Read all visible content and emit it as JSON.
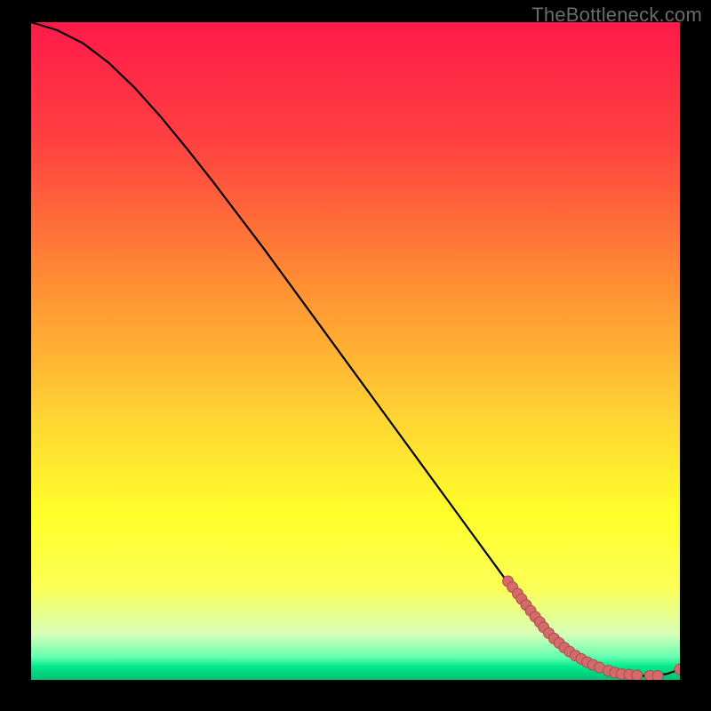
{
  "watermark": "TheBottleneck.com",
  "chart_data": {
    "type": "line",
    "title": "",
    "xlabel": "",
    "ylabel": "",
    "xlim": [
      0,
      100
    ],
    "ylim": [
      0,
      100
    ],
    "background_gradient": {
      "stops": [
        {
          "offset": 0,
          "color": "#ff1a4a"
        },
        {
          "offset": 18,
          "color": "#ff4040"
        },
        {
          "offset": 40,
          "color": "#ff8f33"
        },
        {
          "offset": 60,
          "color": "#ffd433"
        },
        {
          "offset": 75,
          "color": "#ffff2a"
        },
        {
          "offset": 86,
          "color": "#fbff55"
        },
        {
          "offset": 93,
          "color": "#d8ffb8"
        },
        {
          "offset": 96.5,
          "color": "#66ffb0"
        },
        {
          "offset": 98,
          "color": "#00e88a"
        },
        {
          "offset": 100,
          "color": "#00c074"
        }
      ]
    },
    "series": [
      {
        "name": "curve",
        "stroke": "#000000",
        "x": [
          0,
          4,
          8,
          12,
          16,
          20,
          24,
          28,
          32,
          36,
          40,
          44,
          48,
          52,
          56,
          60,
          64,
          68,
          72,
          76,
          80,
          84,
          86,
          88,
          90,
          92,
          94,
          96,
          98,
          100
        ],
        "y": [
          100,
          98.8,
          96.8,
          93.8,
          90.0,
          85.6,
          80.8,
          75.8,
          70.6,
          65.4,
          60.0,
          54.6,
          49.2,
          43.8,
          38.4,
          33.0,
          27.6,
          22.2,
          16.8,
          11.4,
          6.8,
          3.4,
          2.4,
          1.6,
          1.0,
          0.7,
          0.6,
          0.7,
          0.9,
          1.6
        ]
      }
    ],
    "points": {
      "name": "markers",
      "color": "#d66a6a",
      "stroke": "#a84e4e",
      "radius": 6,
      "x": [
        73.5,
        74.2,
        75.0,
        75.6,
        76.3,
        77.0,
        77.7,
        78.4,
        79.0,
        79.8,
        80.6,
        81.4,
        82.2,
        83.0,
        83.9,
        84.8,
        85.7,
        86.6,
        87.6,
        89.0,
        90.0,
        91.0,
        92.2,
        93.4,
        95.4,
        96.6,
        100
      ],
      "y": [
        15.0,
        14.1,
        13.1,
        12.3,
        11.4,
        10.5,
        9.6,
        8.8,
        8.0,
        7.1,
        6.3,
        5.6,
        4.9,
        4.3,
        3.7,
        3.2,
        2.7,
        2.3,
        1.9,
        1.4,
        1.1,
        0.9,
        0.8,
        0.7,
        0.6,
        0.6,
        1.6
      ]
    }
  }
}
